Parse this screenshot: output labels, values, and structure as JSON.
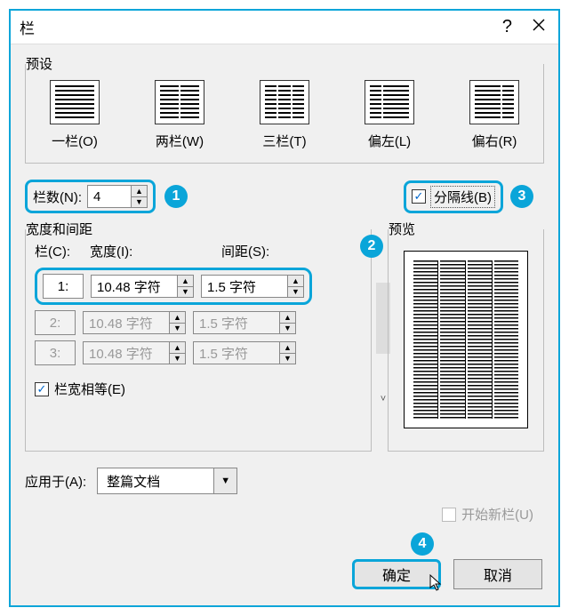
{
  "title": "栏",
  "presets_label": "预设",
  "presets": {
    "one": "一栏(O)",
    "two": "两栏(W)",
    "three": "三栏(T)",
    "left": "偏左(L)",
    "right": "偏右(R)"
  },
  "numcols_label": "栏数(N):",
  "numcols_value": "4",
  "separator_label": "分隔线(B)",
  "separator_checked": true,
  "ws_legend": "宽度和间距",
  "ws_headers": {
    "col": "栏(C):",
    "width": "宽度(I):",
    "spacing": "间距(S):"
  },
  "rows": [
    {
      "idx": "1:",
      "width": "10.48 字符",
      "spacing": "1.5 字符",
      "enabled": true
    },
    {
      "idx": "2:",
      "width": "10.48 字符",
      "spacing": "1.5 字符",
      "enabled": false
    },
    {
      "idx": "3:",
      "width": "10.48 字符",
      "spacing": "1.5 字符",
      "enabled": false
    }
  ],
  "equal_label": "栏宽相等(E)",
  "equal_checked": true,
  "preview_label": "预览",
  "apply_label": "应用于(A):",
  "apply_value": "整篇文档",
  "newcol_label": "开始新栏(U)",
  "ok_label": "确定",
  "cancel_label": "取消",
  "callouts": {
    "c1": "1",
    "c2": "2",
    "c3": "3",
    "c4": "4"
  }
}
